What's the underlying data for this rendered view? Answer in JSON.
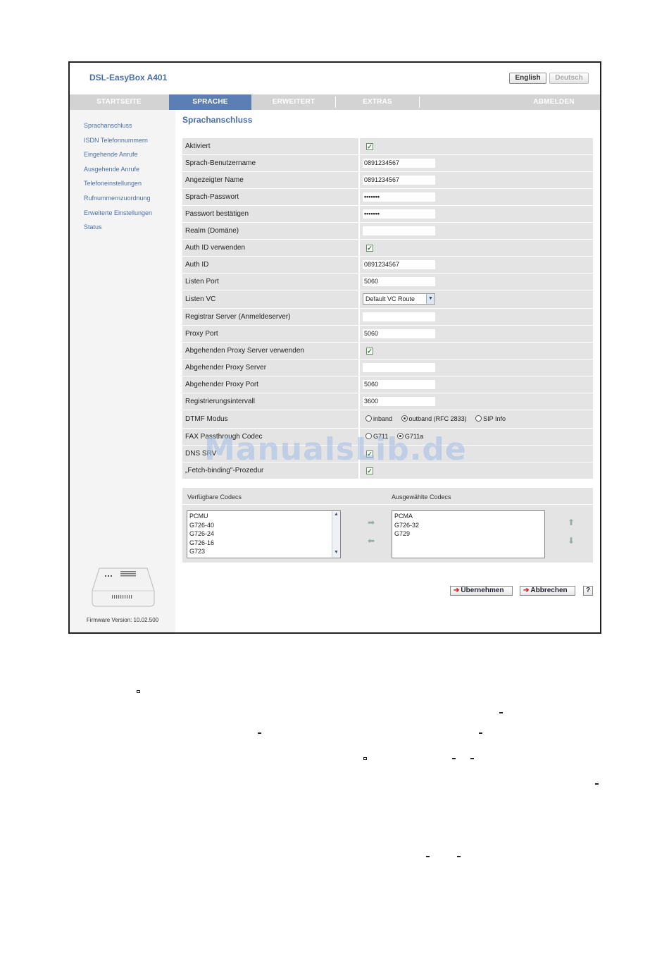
{
  "app": {
    "title": "DSL-EasyBox A401"
  },
  "languages": {
    "english": "English",
    "deutsch": "Deutsch"
  },
  "nav": {
    "startseite": "STARTSEITE",
    "sprache": "SPRACHE",
    "erweitert": "ERWEITERT",
    "extras": "EXTRAS",
    "abmelden": "ABMELDEN"
  },
  "sidebar": {
    "items": [
      "Sprachanschluss",
      "ISDN Telefonnummern",
      "Eingehende Anrufe",
      "Ausgehende Anrufe",
      "Telefoneinstellungen",
      "Rufnummernzuordnung",
      "Erweiterte Einstellungen",
      "Status"
    ],
    "firmware": "Firmware Version: 10.02.500"
  },
  "section": {
    "title": "Sprachanschluss"
  },
  "form": {
    "aktiviert": "Aktiviert",
    "benutzername_label": "Sprach-Benutzername",
    "benutzername_value": "0891234567",
    "angezeigter_name_label": "Angezeigter Name",
    "angezeigter_name_value": "0891234567",
    "passwort_label": "Sprach-Passwort",
    "passwort_value": "•••••••",
    "passwort_best_label": "Passwort bestätigen",
    "passwort_best_value": "•••••••",
    "realm_label": "Realm (Domäne)",
    "realm_value": "",
    "auth_id_verwenden_label": "Auth ID verwenden",
    "auth_id_label": "Auth ID",
    "auth_id_value": "0891234567",
    "listen_port_label": "Listen Port",
    "listen_port_value": "5060",
    "listen_vc_label": "Listen VC",
    "listen_vc_value": "Default VC Route",
    "registrar_label": "Registrar Server (Anmeldeserver)",
    "registrar_value": "",
    "proxy_port_label": "Proxy Port",
    "proxy_port_value": "5060",
    "abg_proxy_verwenden_label": "Abgehenden Proxy Server verwenden",
    "abg_proxy_server_label": "Abgehender Proxy Server",
    "abg_proxy_server_value": "",
    "abg_proxy_port_label": "Abgehender Proxy Port",
    "abg_proxy_port_value": "5060",
    "reg_intervall_label": "Registrierungsintervall",
    "reg_intervall_value": "3600",
    "dtmf_label": "DTMF Modus",
    "dtmf_inband": "inband",
    "dtmf_outband": "outband (RFC 2833)",
    "dtmf_sip": "SIP Info",
    "fax_label": "FAX Passthrough Codec",
    "fax_g711": "G711",
    "fax_g711a": "G711a",
    "dns_label": "DNS SRV",
    "fetch_label": "„Fetch-binding\"-Prozedur"
  },
  "codecs": {
    "available_header": "Verfügbare Codecs",
    "selected_header": "Ausgewählte Codecs",
    "available": [
      "PCMU",
      "G726-40",
      "G726-24",
      "G726-16",
      "G723"
    ],
    "selected": [
      "PCMA",
      "G726-32",
      "G729"
    ]
  },
  "actions": {
    "uebernehmen": "Übernehmen",
    "abbrechen": "Abbrechen",
    "help": "?"
  },
  "watermark": "ManualsLib.de",
  "colors": {
    "accent": "#5b7fb5",
    "link": "#4a6fa5",
    "row_bg": "#e4e4e4",
    "nav_bg": "#d3d3d3"
  }
}
